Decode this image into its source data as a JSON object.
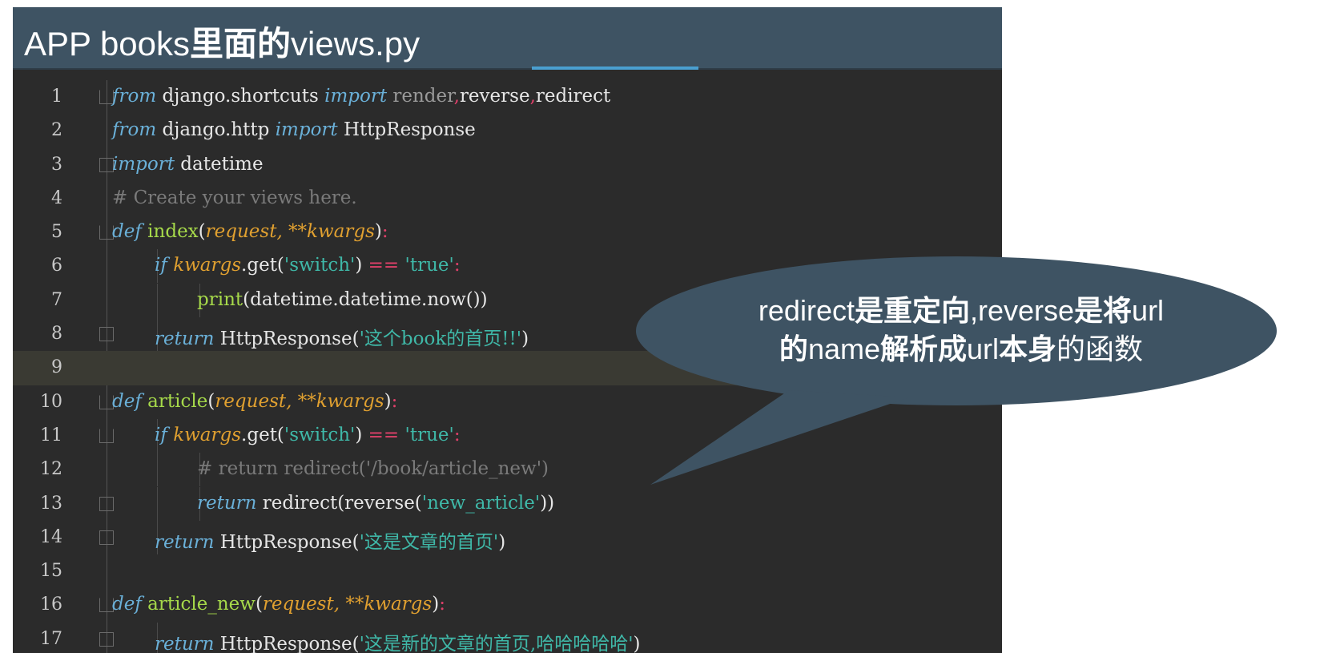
{
  "title": {
    "prefix": "APP books",
    "bold": "里面的",
    "suffix": "views.py"
  },
  "callout": {
    "line1": [
      {
        "t": "redirect",
        "b": false
      },
      {
        "t": "是重定向",
        "b": true
      },
      {
        "t": ",reverse",
        "b": false
      },
      {
        "t": "是将",
        "b": true
      },
      {
        "t": "url",
        "b": false
      }
    ],
    "line2": [
      {
        "t": "的",
        "b": true
      },
      {
        "t": "name",
        "b": false
      },
      {
        "t": "解析成",
        "b": true
      },
      {
        "t": "url",
        "b": false
      },
      {
        "t": "本身",
        "b": true
      },
      {
        "t": "的函数",
        "b": false
      }
    ]
  },
  "colors": {
    "editor_bg": "#2b2b2b",
    "titlebar": "#3e5363",
    "bubble": "#3e5363"
  },
  "code_lines": [
    {
      "num": "1",
      "indent": 0,
      "fold": "down",
      "tokens": [
        {
          "t": "from",
          "c": "kw"
        },
        {
          "t": " django.shortcuts ",
          "c": "plain"
        },
        {
          "t": "import",
          "c": "kw"
        },
        {
          "t": " render",
          "c": "gray"
        },
        {
          "t": ",",
          "c": "op"
        },
        {
          "t": "reverse",
          "c": "plain"
        },
        {
          "t": ",",
          "c": "op"
        },
        {
          "t": "redirect",
          "c": "plain"
        }
      ]
    },
    {
      "num": "2",
      "indent": 0,
      "fold": "",
      "tokens": [
        {
          "t": "from",
          "c": "kw"
        },
        {
          "t": " django.http ",
          "c": "plain"
        },
        {
          "t": "import",
          "c": "kw"
        },
        {
          "t": " HttpResponse",
          "c": "plain"
        }
      ]
    },
    {
      "num": "3",
      "indent": 0,
      "fold": "up",
      "tokens": [
        {
          "t": "import",
          "c": "kw"
        },
        {
          "t": " datetime",
          "c": "plain"
        }
      ]
    },
    {
      "num": "4",
      "indent": 0,
      "fold": "",
      "tokens": [
        {
          "t": "# Create your views here.",
          "c": "cmt"
        }
      ]
    },
    {
      "num": "5",
      "indent": 0,
      "fold": "down",
      "tokens": [
        {
          "t": "def",
          "c": "kw"
        },
        {
          "t": " ",
          "c": "plain"
        },
        {
          "t": "index",
          "c": "fn"
        },
        {
          "t": "(",
          "c": "plain"
        },
        {
          "t": "request, **kwargs",
          "c": "par"
        },
        {
          "t": ")",
          "c": "plain"
        },
        {
          "t": ":",
          "c": "op"
        }
      ]
    },
    {
      "num": "6",
      "indent": 1,
      "fold": "",
      "tokens": [
        {
          "t": "if",
          "c": "kw"
        },
        {
          "t": " ",
          "c": "plain"
        },
        {
          "t": "kwargs",
          "c": "par"
        },
        {
          "t": ".get(",
          "c": "plain"
        },
        {
          "t": "'switch'",
          "c": "str"
        },
        {
          "t": ") ",
          "c": "plain"
        },
        {
          "t": "==",
          "c": "op"
        },
        {
          "t": " ",
          "c": "plain"
        },
        {
          "t": "'true'",
          "c": "str"
        },
        {
          "t": ":",
          "c": "op"
        }
      ]
    },
    {
      "num": "7",
      "indent": 2,
      "fold": "",
      "tokens": [
        {
          "t": "print",
          "c": "fn"
        },
        {
          "t": "(datetime.datetime.now())",
          "c": "plain"
        }
      ]
    },
    {
      "num": "8",
      "indent": 1,
      "fold": "up",
      "tokens": [
        {
          "t": "return",
          "c": "kw"
        },
        {
          "t": " HttpResponse(",
          "c": "plain"
        },
        {
          "t": "'这个book的首页!!'",
          "c": "str"
        },
        {
          "t": ")",
          "c": "plain"
        }
      ]
    },
    {
      "num": "9",
      "indent": 0,
      "fold": "",
      "current": true,
      "tokens": []
    },
    {
      "num": "10",
      "indent": 0,
      "fold": "down",
      "tokens": [
        {
          "t": "def",
          "c": "kw"
        },
        {
          "t": " ",
          "c": "plain"
        },
        {
          "t": "article",
          "c": "fn"
        },
        {
          "t": "(",
          "c": "plain"
        },
        {
          "t": "request, **kwargs",
          "c": "par"
        },
        {
          "t": ")",
          "c": "plain"
        },
        {
          "t": ":",
          "c": "op"
        }
      ]
    },
    {
      "num": "11",
      "indent": 1,
      "fold": "down",
      "tokens": [
        {
          "t": "if",
          "c": "kw"
        },
        {
          "t": " ",
          "c": "plain"
        },
        {
          "t": "kwargs",
          "c": "par"
        },
        {
          "t": ".get(",
          "c": "plain"
        },
        {
          "t": "'switch'",
          "c": "str"
        },
        {
          "t": ") ",
          "c": "plain"
        },
        {
          "t": "==",
          "c": "op"
        },
        {
          "t": " ",
          "c": "plain"
        },
        {
          "t": "'true'",
          "c": "str"
        },
        {
          "t": ":",
          "c": "op"
        }
      ]
    },
    {
      "num": "12",
      "indent": 2,
      "fold": "",
      "tokens": [
        {
          "t": "# return redirect('/book/article_new')",
          "c": "cmt"
        }
      ]
    },
    {
      "num": "13",
      "indent": 2,
      "fold": "up",
      "tokens": [
        {
          "t": "return",
          "c": "kw"
        },
        {
          "t": " redirect(reverse(",
          "c": "plain"
        },
        {
          "t": "'new_article'",
          "c": "str"
        },
        {
          "t": "))",
          "c": "plain"
        }
      ]
    },
    {
      "num": "14",
      "indent": 1,
      "fold": "up",
      "tokens": [
        {
          "t": "return",
          "c": "kw"
        },
        {
          "t": " HttpResponse(",
          "c": "plain"
        },
        {
          "t": "'这是文章的首页'",
          "c": "str"
        },
        {
          "t": ")",
          "c": "plain"
        }
      ]
    },
    {
      "num": "15",
      "indent": 0,
      "fold": "",
      "tokens": []
    },
    {
      "num": "16",
      "indent": 0,
      "fold": "down",
      "tokens": [
        {
          "t": "def",
          "c": "kw"
        },
        {
          "t": " ",
          "c": "plain"
        },
        {
          "t": "article_new",
          "c": "fn"
        },
        {
          "t": "(",
          "c": "plain"
        },
        {
          "t": "request, **kwargs",
          "c": "par"
        },
        {
          "t": ")",
          "c": "plain"
        },
        {
          "t": ":",
          "c": "op"
        }
      ]
    },
    {
      "num": "17",
      "indent": 1,
      "fold": "up",
      "tokens": [
        {
          "t": "return",
          "c": "kw"
        },
        {
          "t": " HttpResponse(",
          "c": "plain"
        },
        {
          "t": "'这是新的文章的首页,哈哈哈哈哈'",
          "c": "str"
        },
        {
          "t": ")",
          "c": "plain"
        }
      ]
    }
  ]
}
